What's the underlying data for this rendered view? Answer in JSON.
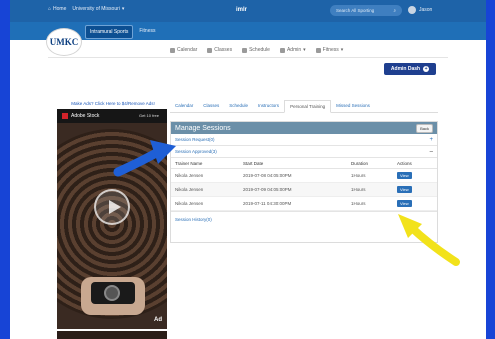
{
  "topbar": {
    "home": "Home",
    "university": "University of Missouri",
    "brand": "imlr",
    "search_placeholder": "Search All Sporting",
    "user": "Jason"
  },
  "subnav": {
    "tabs": [
      "Intramural Sports",
      "Fitness"
    ]
  },
  "logo": "UMKC",
  "mainmenu": [
    "Calendar",
    "Classes",
    "Schedule",
    "Admin",
    "Fitness"
  ],
  "admin_dash": "Admin Dash",
  "ad": {
    "label": "Make Ads? Click Here to $4/Remove Ads!",
    "brand": "Adobe Stock",
    "corner": "Get 10 free",
    "mark": "Ad"
  },
  "content_tabs": [
    "Calendar",
    "Classes",
    "Schedule",
    "Instructors",
    "Personal Training",
    "Missed Sessions"
  ],
  "panel": {
    "title": "Manage Sessions",
    "back": "Back",
    "session_request": "Session Request(0)",
    "session_approved": "Session Approved(3)",
    "headers": [
      "Trainer Name",
      "Start Date",
      "Duration",
      "Actions"
    ],
    "rows": [
      {
        "trainer": "Nikola Jensen",
        "start": "2019-07-08 04:05:00PM",
        "duration": "1Hours",
        "action": "View"
      },
      {
        "trainer": "Nikola Jensen",
        "start": "2019-07-09 04:05:00PM",
        "duration": "1Hours",
        "action": "View"
      },
      {
        "trainer": "Nikola Jensen",
        "start": "2019-07-11 04:30:00PM",
        "duration": "1Hours",
        "action": "View"
      }
    ],
    "session_history": "Session History(0)"
  },
  "colors": {
    "background": "#1744d6",
    "header": "#1e63a8",
    "panel_head": "#6b8fa8",
    "blue_arrow": "#1f5fd6",
    "yellow_arrow": "#f2e21a"
  }
}
